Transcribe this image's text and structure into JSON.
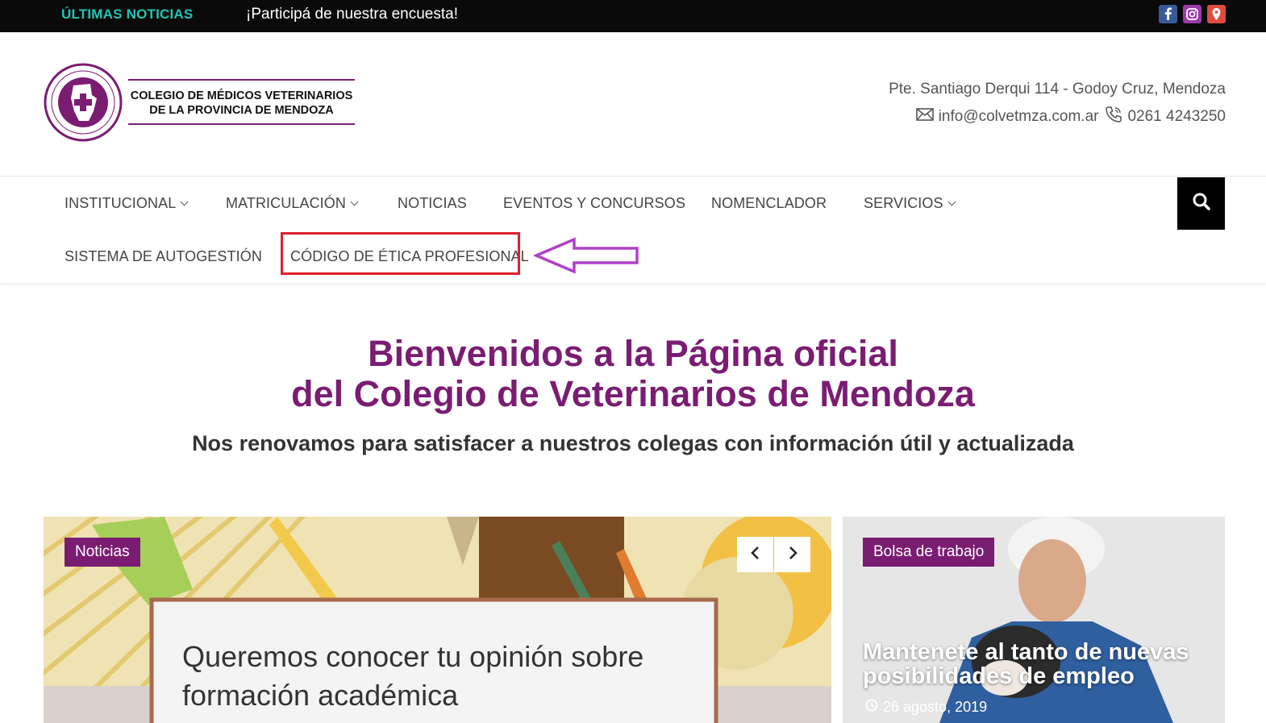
{
  "topbar": {
    "ticker_label": "ÚLTIMAS NOTICIAS",
    "ticker_text": "¡Participá de nuestra encuesta!",
    "social": [
      "facebook-icon",
      "instagram-icon",
      "map-pin-icon"
    ]
  },
  "header": {
    "logo_line1": "COLEGIO DE MÉDICOS VETERINARIOS",
    "logo_line2": "DE LA PROVINCIA DE MENDOZA",
    "address": "Pte. Santiago Derqui 114 - Godoy Cruz, Mendoza",
    "email": "info@colvetmza.com.ar",
    "phone": "0261 4243250"
  },
  "nav": {
    "items": [
      {
        "label": "INSTITUCIONAL",
        "dropdown": true
      },
      {
        "label": "MATRICULACIÓN",
        "dropdown": true
      },
      {
        "label": "NOTICIAS",
        "dropdown": false
      },
      {
        "label": "EVENTOS Y CONCURSOS",
        "dropdown": false
      },
      {
        "label": "NOMENCLADOR",
        "dropdown": false
      },
      {
        "label": "SERVICIOS",
        "dropdown": true
      },
      {
        "label": "SISTEMA DE AUTOGESTIÓN",
        "dropdown": false
      },
      {
        "label": "CÓDIGO DE ÉTICA PROFESIONAL",
        "dropdown": false
      }
    ]
  },
  "hero": {
    "title_line1": "Bienvenidos a la Página oficial",
    "title_line2": "del Colegio de Veterinarios de Mendoza",
    "subtitle": "Nos renovamos para satisfacer a nuestros colegas con información útil y actualizada"
  },
  "slider": {
    "tag": "Noticias",
    "headline": "Queremos conocer tu opinión sobre formación académica"
  },
  "side_card": {
    "tag": "Bolsa de trabajo",
    "title": "Mantenete al tanto de nuevas posibilidades de empleo",
    "date": "26 agosto, 2019"
  },
  "colors": {
    "brand": "#7b1c73",
    "ticker_accent": "#1fc7b6",
    "highlight": "#e01f2e",
    "annotation_arrow": "#b040c8"
  }
}
